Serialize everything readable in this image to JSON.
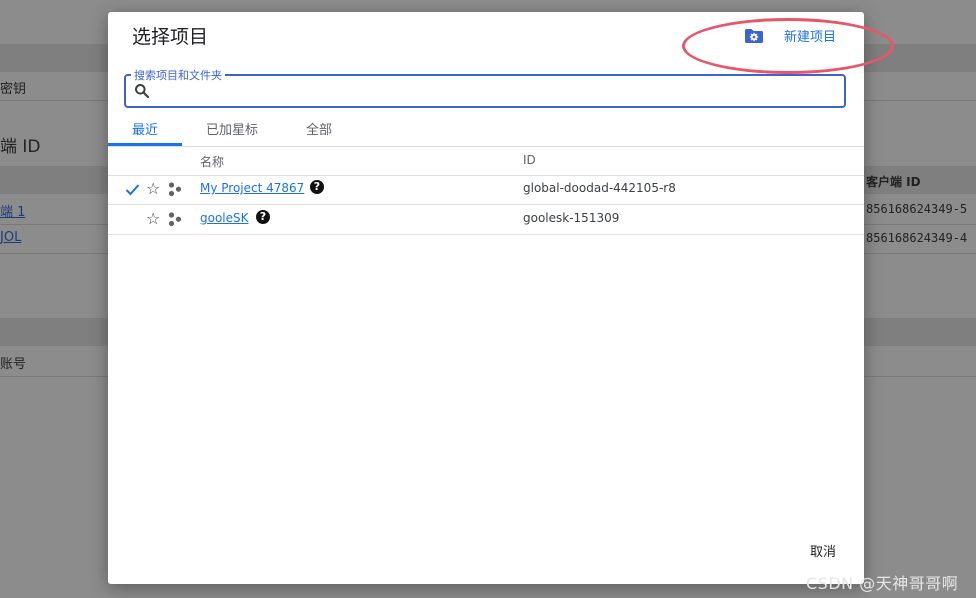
{
  "background": {
    "labels": {
      "key_section": "密钥",
      "client_id_heading": "端 ID",
      "client_row_1": "端 1",
      "client_row_2": "JOL",
      "account_label": "账号",
      "client_id_column": "客户端 ID",
      "client_value_1": "856168624349-5",
      "client_value_2": "856168624349-4"
    }
  },
  "dialog": {
    "title": "选择项目",
    "new_project_label": "新建项目",
    "search": {
      "legend": "搜索项目和文件夹",
      "value": ""
    },
    "tabs": [
      {
        "label": "最近",
        "active": true
      },
      {
        "label": "已加星标",
        "active": false
      },
      {
        "label": "全部",
        "active": false
      }
    ],
    "table": {
      "headers": {
        "name": "名称",
        "id": "ID"
      },
      "rows": [
        {
          "selected": true,
          "name": "My Project 47867",
          "help": "?",
          "id": "global-doodad-442105-r8"
        },
        {
          "selected": false,
          "name": "gooleSK",
          "help": "?",
          "id": "goolesk-151309"
        }
      ]
    },
    "cancel_label": "取消"
  },
  "watermark": "CSDN @天神哥哥啊",
  "colors": {
    "accent": "#1a73e8",
    "search_border": "#3b63d4",
    "highlight_ellipse": "#e8566a",
    "backdrop": "#8c8c8c"
  },
  "icons": {
    "new_project": "folder-gear-icon",
    "search": "search-icon",
    "selected": "checkmark-icon",
    "star": "star-outline-icon",
    "organization": "org-icon",
    "help": "help-circle-icon"
  }
}
